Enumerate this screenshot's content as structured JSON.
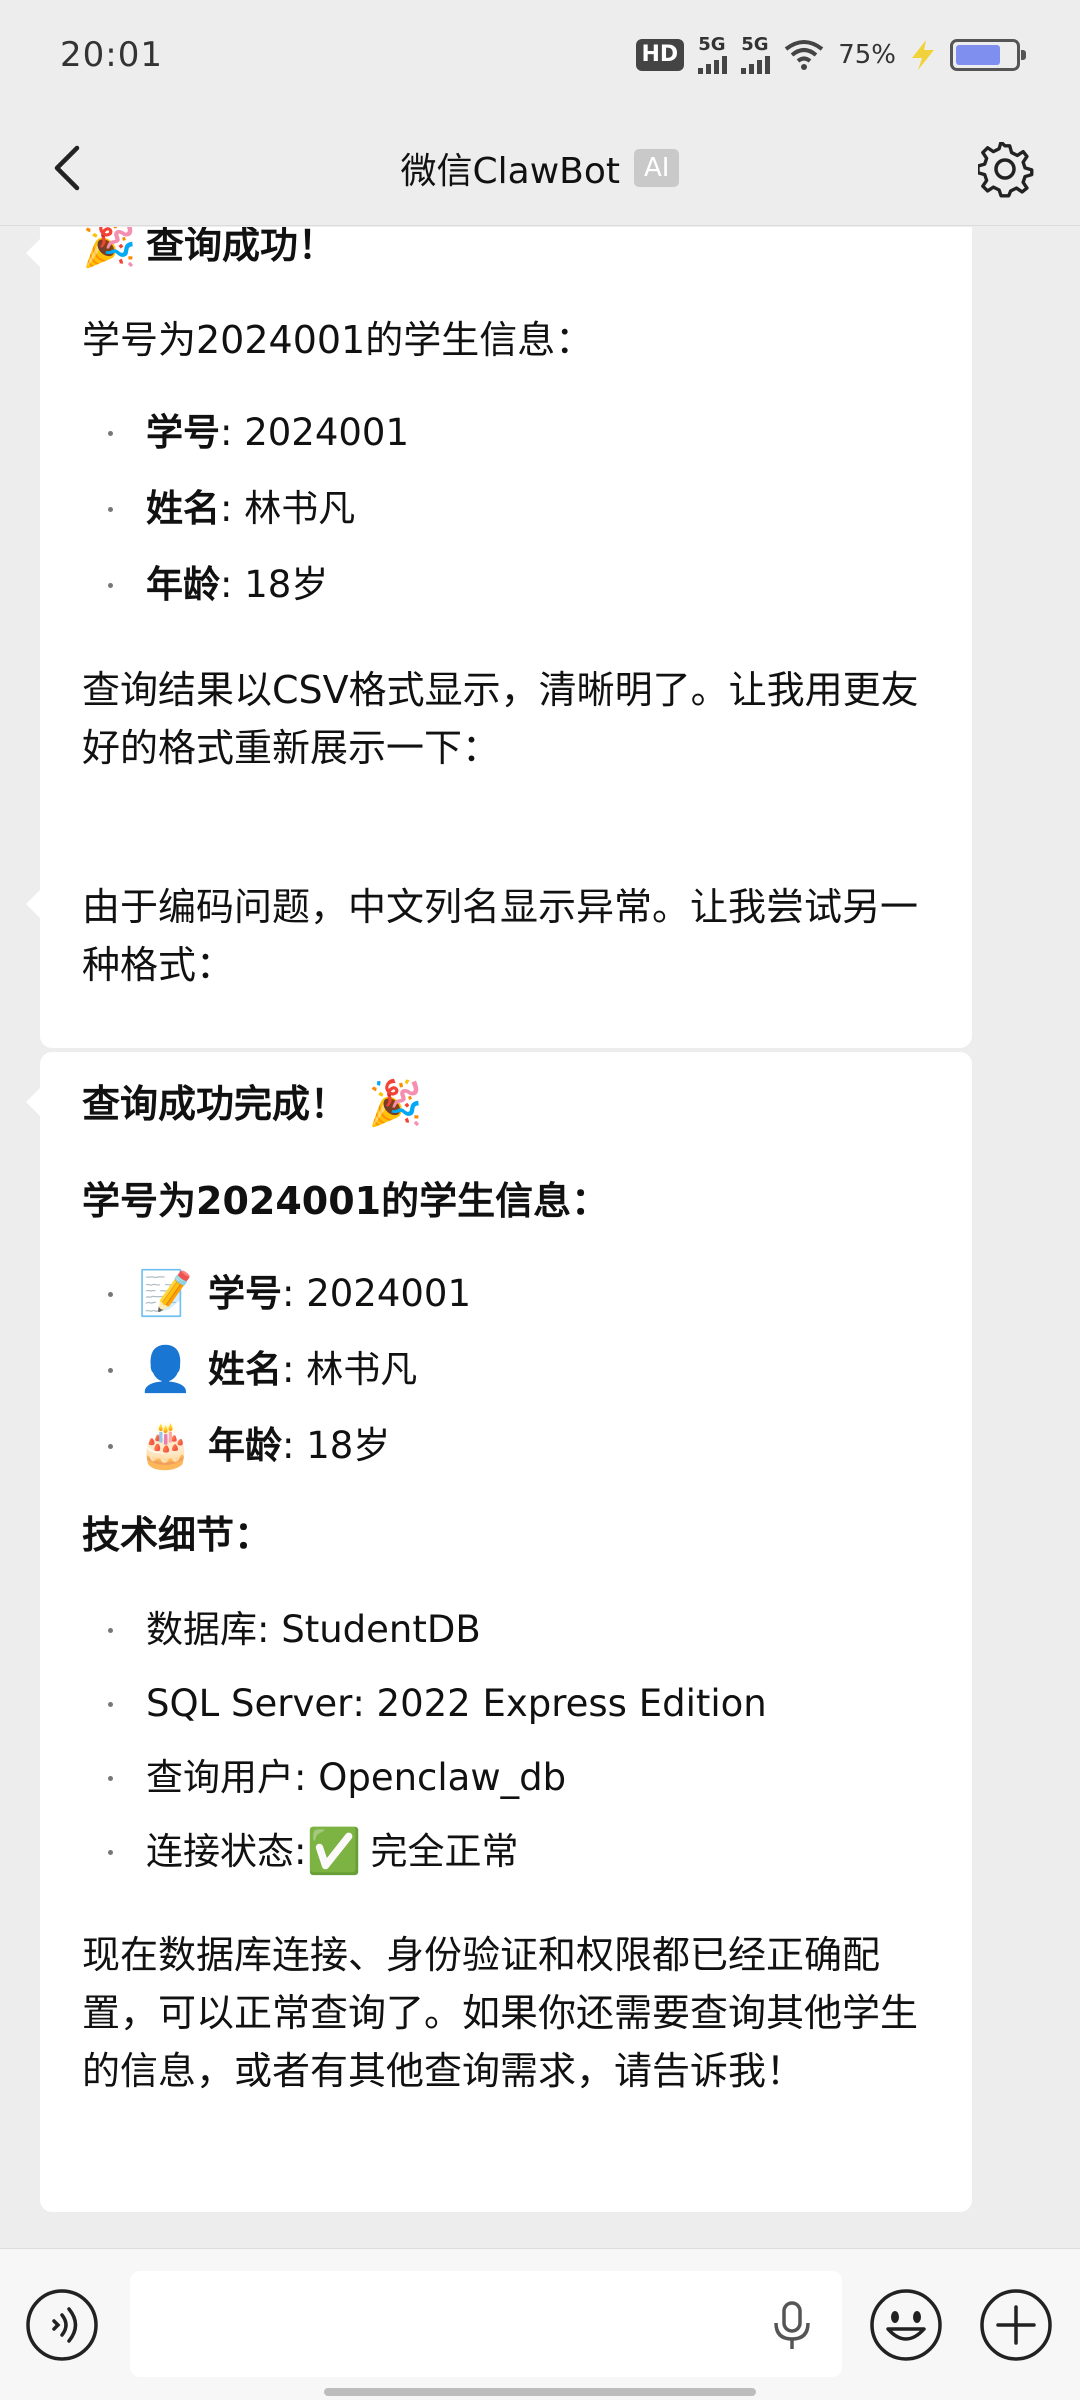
{
  "status_bar": {
    "time": "20:01",
    "hd_label": "HD",
    "net1": "5G",
    "net2": "5G",
    "battery_pct": "75%",
    "battery_level": 0.75
  },
  "header": {
    "title": "微信ClawBot",
    "badge": "AI",
    "back_icon": "chevron-left-icon",
    "settings_icon": "gear-icon"
  },
  "messages": {
    "m1": {
      "headline_emoji": "🎉",
      "headline": "查询成功！",
      "intro": "学号为2024001的学生信息：",
      "items": [
        {
          "key": "学号",
          "value": ": 2024001"
        },
        {
          "key": "姓名",
          "value": ": 林书凡"
        },
        {
          "key": "年龄",
          "value": ": 18岁"
        }
      ],
      "outro": "查询结果以CSV格式显示，清晰明了。让我用更友好的格式重新展示一下："
    },
    "m2": {
      "text": "由于编码问题，中文列名显示异常。让我尝试另一种格式："
    },
    "m3": {
      "headline": "查询成功完成！",
      "headline_emoji": "🎉",
      "intro": "学号为2024001的学生信息：",
      "items": [
        {
          "emoji": "📝",
          "key": "学号",
          "value": ": 2024001"
        },
        {
          "emoji": "👤",
          "key": "姓名",
          "value": ": 林书凡"
        },
        {
          "emoji": "🎂",
          "key": "年龄",
          "value": ": 18岁"
        }
      ],
      "tech_title": "技术细节：",
      "tech_items": [
        {
          "key": "数据库",
          "value": ": StudentDB"
        },
        {
          "key": "SQL Server",
          "value": ": 2022 Express Edition"
        },
        {
          "key": "查询用户",
          "value": ": Openclaw_db"
        },
        {
          "key": "连接状态",
          "value": ": ",
          "emoji": "✅",
          "after": "完全正常"
        }
      ],
      "outro": "现在数据库连接、身份验证和权限都已经正确配置，可以正常查询了。如果你还需要查询其他学生的信息，或者有其他查询需求，请告诉我！"
    }
  },
  "input_bar": {
    "voice_icon": "voice-icon",
    "mic_icon": "mic-icon",
    "emoji_icon": "emoji-icon",
    "plus_icon": "plus-icon",
    "placeholder": ""
  },
  "colors": {
    "background": "#ededed",
    "bubble": "#ffffff",
    "battery": "#7f8ff0"
  }
}
